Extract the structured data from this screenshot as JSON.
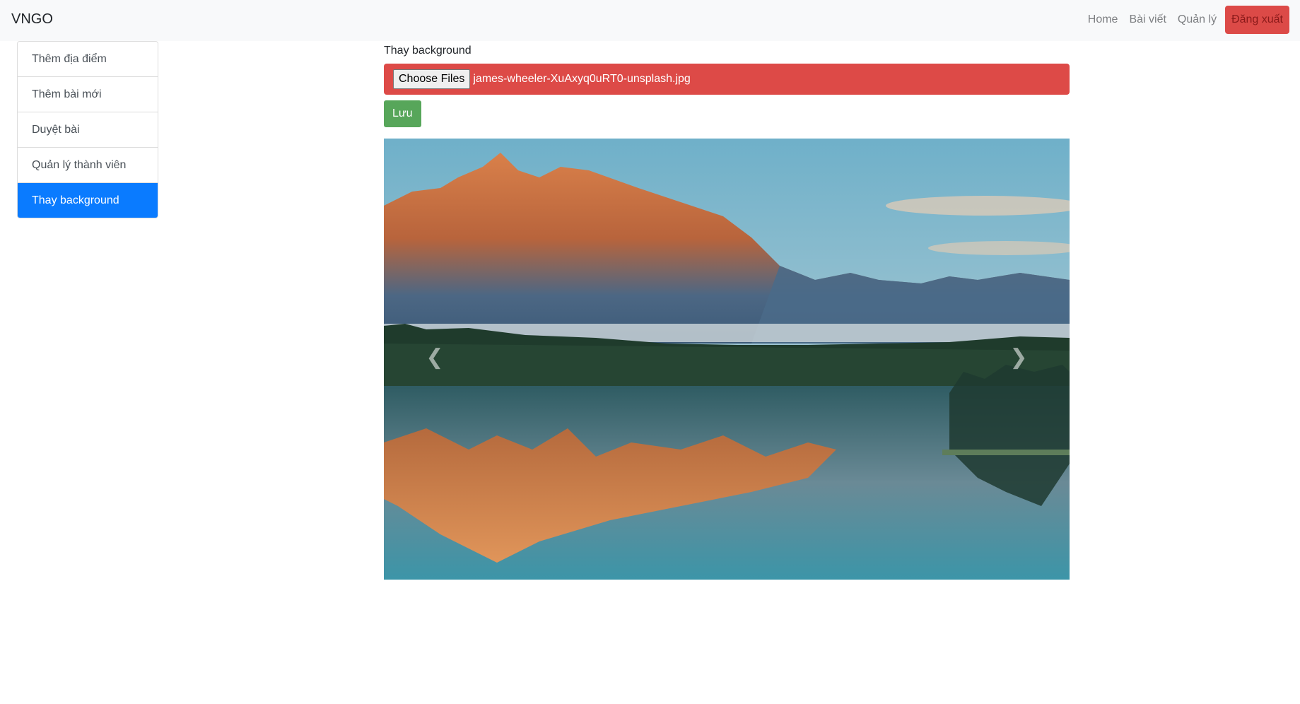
{
  "navbar": {
    "brand": "VNGO",
    "links": [
      "Home",
      "Bài viết",
      "Quản lý"
    ],
    "logout_label": "Đăng xuất"
  },
  "sidebar": {
    "items": [
      {
        "label": "Thêm địa điểm"
      },
      {
        "label": "Thêm bài mới"
      },
      {
        "label": "Duyệt bài"
      },
      {
        "label": "Quản lý thành viên"
      },
      {
        "label": "Thay background",
        "active": true
      }
    ]
  },
  "main": {
    "section_label": "Thay background",
    "file_input": {
      "button_label": "Choose Files",
      "file_name": "james-wheeler-XuAxyq0uRT0-unsplash.jpg"
    },
    "save_label": "Lưu",
    "carousel": {
      "prev_icon": "chevron-left-icon",
      "next_icon": "chevron-right-icon"
    }
  },
  "colors": {
    "navbar_bg": "#f8f9fa",
    "logout_bg": "#dc4a47",
    "active_item": "#0a7bff",
    "file_bar": "#dd4a47",
    "save_button": "#57a65a"
  }
}
